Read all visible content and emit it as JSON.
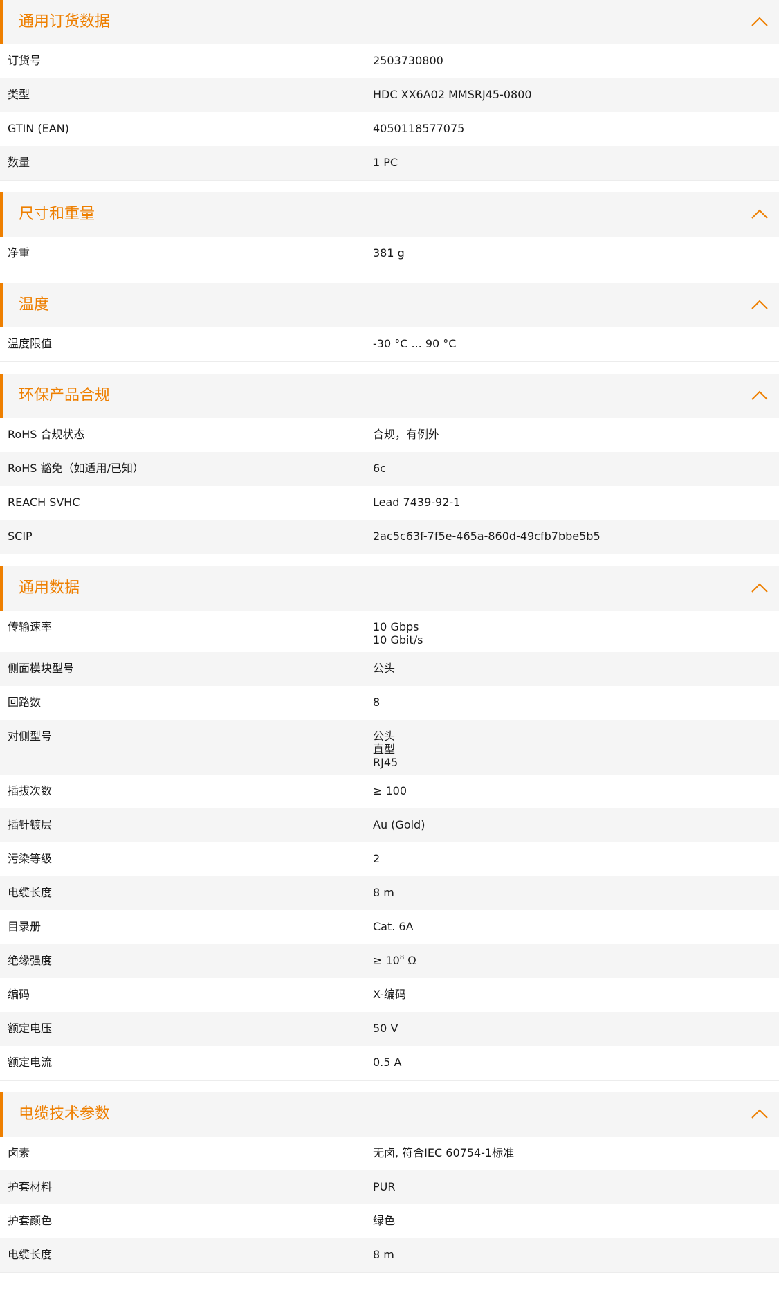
{
  "colors": {
    "accent": "#ee7f00",
    "header_bg": "#f5f5f5",
    "row_alt": "#f5f5f5"
  },
  "icons": {
    "collapse": "chevron-up-icon"
  },
  "sections": [
    {
      "title": "通用订货数据",
      "rows": [
        {
          "label": "订货号",
          "values": [
            "2503730800"
          ]
        },
        {
          "label": "类型",
          "values": [
            "HDC XX6A02 MMSRJ45-0800"
          ]
        },
        {
          "label": "GTIN (EAN)",
          "values": [
            "4050118577075"
          ]
        },
        {
          "label": "数量",
          "values": [
            "1  PC"
          ]
        }
      ]
    },
    {
      "title": "尺寸和重量",
      "rows": [
        {
          "label": "净重",
          "values": [
            "381  g"
          ]
        }
      ]
    },
    {
      "title": "温度",
      "rows": [
        {
          "label": "温度限值",
          "values": [
            "-30 °C ... 90 °C"
          ]
        }
      ]
    },
    {
      "title": "环保产品合规",
      "rows": [
        {
          "label": "RoHS 合规状态",
          "values": [
            "合规，有例外"
          ]
        },
        {
          "label": "RoHS 豁免（如适用/已知）",
          "values": [
            "6c"
          ]
        },
        {
          "label": "REACH SVHC",
          "values": [
            "Lead 7439-92-1"
          ]
        },
        {
          "label": "SCIP",
          "values": [
            "2ac5c63f-7f5e-465a-860d-49cfb7bbe5b5"
          ]
        }
      ]
    },
    {
      "title": "通用数据",
      "rows": [
        {
          "label": "传输速率",
          "values": [
            "10 Gbps",
            "10 Gbit/s"
          ]
        },
        {
          "label": "侧面模块型号",
          "values": [
            "公头"
          ]
        },
        {
          "label": "回路数",
          "values": [
            "8"
          ]
        },
        {
          "label": "对侧型号",
          "values": [
            "公头",
            "直型",
            "RJ45"
          ]
        },
        {
          "label": "插拔次数",
          "values": [
            "≥ 100"
          ]
        },
        {
          "label": "插针镀层",
          "values": [
            "Au (Gold)"
          ]
        },
        {
          "label": "污染等级",
          "values": [
            "2"
          ]
        },
        {
          "label": "电缆长度",
          "values": [
            "8  m"
          ]
        },
        {
          "label": "目录册",
          "values": [
            "Cat. 6A"
          ]
        },
        {
          "label": "绝缘强度",
          "values": [
            "≥ 10"
          ],
          "sup": "8",
          "suffix": " Ω"
        },
        {
          "label": "编码",
          "values": [
            "X-编码"
          ]
        },
        {
          "label": "额定电压",
          "values": [
            "50  V"
          ]
        },
        {
          "label": "额定电流",
          "values": [
            "0.5  A"
          ]
        }
      ]
    },
    {
      "title": "电缆技术参数",
      "rows": [
        {
          "label": "卤素",
          "values": [
            "无卤, 符合IEC 60754-1标准"
          ]
        },
        {
          "label": "护套材料",
          "values": [
            "PUR"
          ]
        },
        {
          "label": "护套颜色",
          "values": [
            "绿色"
          ]
        },
        {
          "label": "电缆长度",
          "values": [
            "8  m"
          ]
        }
      ]
    }
  ]
}
